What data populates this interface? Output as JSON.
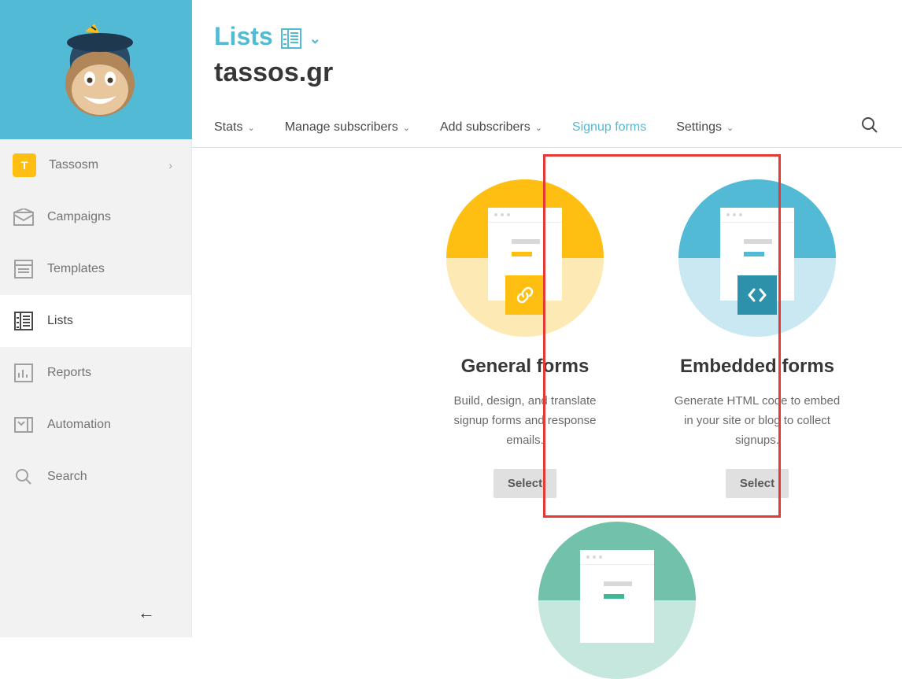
{
  "sidebar": {
    "user": {
      "initial": "T",
      "name": "Tassosm"
    },
    "items": [
      {
        "label": "Campaigns"
      },
      {
        "label": "Templates"
      },
      {
        "label": "Lists"
      },
      {
        "label": "Reports"
      },
      {
        "label": "Automation"
      },
      {
        "label": "Search"
      }
    ]
  },
  "header": {
    "breadcrumb": "Lists",
    "title": "tassos.gr"
  },
  "tabs": {
    "stats": "Stats",
    "manage": "Manage subscribers",
    "add": "Add subscribers",
    "signup": "Signup forms",
    "settings": "Settings"
  },
  "cards": {
    "general": {
      "title": "General forms",
      "desc": "Build, design, and translate signup forms and response emails.",
      "button": "Select"
    },
    "embedded": {
      "title": "Embedded forms",
      "desc": "Generate HTML code to embed in your site or blog to collect signups.",
      "button": "Select"
    }
  }
}
